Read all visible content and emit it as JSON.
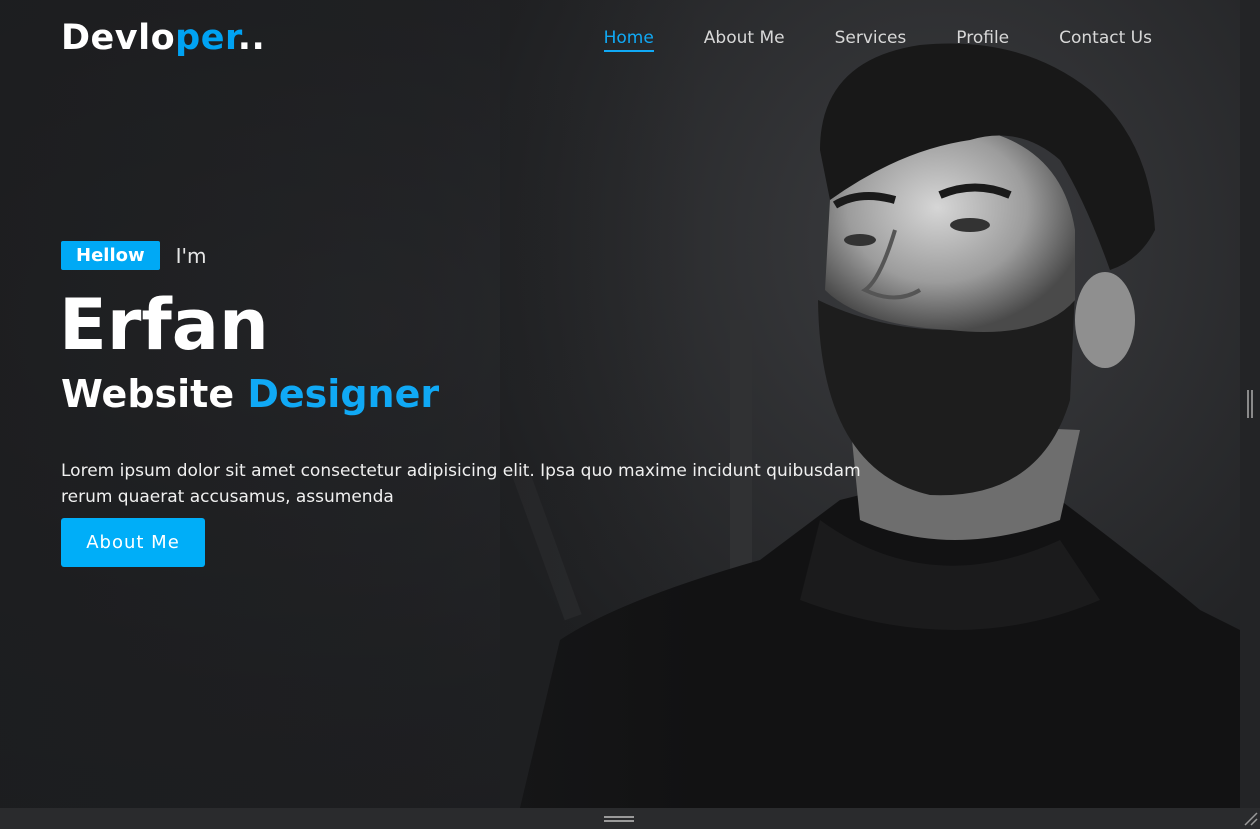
{
  "brand": {
    "logo_part1": "Devlo",
    "logo_part2": "per",
    "logo_part3": "..",
    "accent_color": "#00a2f3"
  },
  "nav": {
    "items": [
      {
        "label": "Home",
        "active": true
      },
      {
        "label": "About Me",
        "active": false
      },
      {
        "label": "Services",
        "active": false
      },
      {
        "label": "Profile",
        "active": false
      },
      {
        "label": "Contact Us",
        "active": false
      }
    ]
  },
  "hero": {
    "badge": "Hellow",
    "intro": "I'm",
    "name": "Erfan",
    "role_part1": "Website",
    "role_part2": "Designer",
    "description": "Lorem ipsum dolor sit amet consectetur adipisicing elit. Ipsa quo maxime incidunt quibusdam rerum quaerat accusamus, assumenda",
    "button_label": "About Me"
  },
  "icons": {
    "vertical_grip": "drag-handle-vertical-icon",
    "horizontal_grip": "drag-handle-horizontal-icon",
    "resize": "resize-corner-icon"
  }
}
